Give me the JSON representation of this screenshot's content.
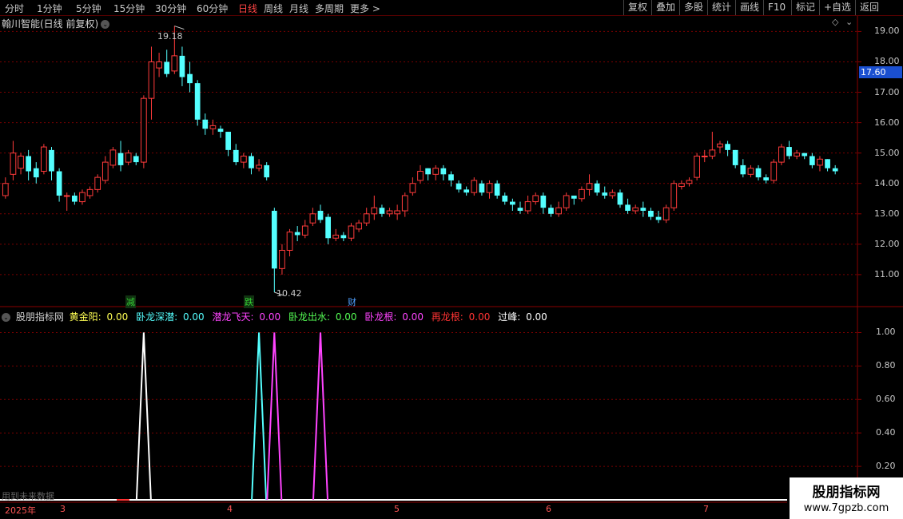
{
  "toolbar": {
    "periods": [
      "分时",
      "1分钟",
      "5分钟",
      "15分钟",
      "30分钟",
      "60分钟",
      "日线",
      "周线",
      "月线",
      "多周期",
      "更多 >"
    ],
    "active_period": "日线",
    "right_buttons": [
      "复权",
      "叠加",
      "多股",
      "统计",
      "画线",
      "F10",
      "标记",
      "+自选",
      "返回"
    ]
  },
  "price_panel": {
    "title": "翰川智能(日线 前复权)",
    "diamond_icon": "◇",
    "high_label": "19.18",
    "low_label": "10.42",
    "current_price": "17.60",
    "y_ticks": [
      "19.00",
      "18.00",
      "17.00",
      "16.00",
      "15.00",
      "14.00",
      "13.00",
      "12.00",
      "11.00"
    ],
    "markers": [
      {
        "text": "减",
        "color": "#33cc33"
      },
      {
        "text": "跌",
        "color": "#33cc33"
      },
      {
        "text": "财",
        "color": "#4fa0ff"
      }
    ]
  },
  "indicator_panel": {
    "name": "股朋指标网",
    "items": [
      {
        "label": "黄金阳:",
        "value": "0.00",
        "color": "#ffff55"
      },
      {
        "label": "卧龙深潜:",
        "value": "0.00",
        "color": "#55ffff"
      },
      {
        "label": "潜龙飞天:",
        "value": "0.00",
        "color": "#ff44ff"
      },
      {
        "label": "卧龙出水:",
        "value": "0.00",
        "color": "#55ff55"
      },
      {
        "label": "卧龙根:",
        "value": "0.00",
        "color": "#ff44ff"
      },
      {
        "label": "再龙根:",
        "value": "0.00",
        "color": "#ff3333"
      },
      {
        "label": "过峰:",
        "value": "0.00",
        "color": "#ffffff"
      }
    ],
    "y_ticks": [
      "1.00",
      "0.80",
      "0.60",
      "0.40",
      "0.20"
    ],
    "future_note": "用到未来数据"
  },
  "date_axis": {
    "year": "2025年",
    "months": [
      "3",
      "4",
      "5",
      "6",
      "7"
    ]
  },
  "watermark": {
    "line1": "股朋指标网",
    "line2": "www.7gpzb.com"
  },
  "chart_data": {
    "type": "candlestick",
    "ylim": [
      10.0,
      19.3
    ],
    "candles": [
      [
        13.6,
        14.0,
        13.5,
        14.2
      ],
      [
        14.3,
        15.0,
        14.1,
        15.4
      ],
      [
        14.5,
        14.9,
        14.3,
        15.0
      ],
      [
        14.9,
        14.4,
        14.1,
        15.1
      ],
      [
        14.5,
        14.2,
        14.0,
        14.7
      ],
      [
        14.4,
        15.2,
        14.3,
        15.3
      ],
      [
        15.1,
        14.4,
        14.1,
        15.2
      ],
      [
        14.4,
        13.6,
        13.4,
        14.5
      ],
      [
        13.6,
        13.6,
        13.1,
        13.7
      ],
      [
        13.6,
        13.4,
        13.3,
        13.7
      ],
      [
        13.4,
        13.7,
        13.3,
        13.8
      ],
      [
        13.6,
        13.8,
        13.5,
        13.9
      ],
      [
        13.8,
        14.2,
        13.7,
        14.3
      ],
      [
        14.1,
        14.7,
        14.0,
        14.9
      ],
      [
        14.6,
        15.1,
        14.5,
        15.2
      ],
      [
        15.0,
        14.6,
        14.4,
        15.4
      ],
      [
        14.7,
        15.0,
        14.6,
        15.1
      ],
      [
        14.9,
        14.7,
        14.6,
        15.0
      ],
      [
        14.7,
        16.8,
        14.5,
        16.9
      ],
      [
        16.8,
        18.0,
        16.1,
        18.5
      ],
      [
        17.8,
        18.0,
        17.5,
        18.3
      ],
      [
        18.0,
        17.6,
        17.5,
        18.4
      ],
      [
        17.7,
        18.2,
        17.6,
        19.18
      ],
      [
        18.2,
        17.5,
        17.2,
        18.5
      ],
      [
        17.6,
        17.3,
        17.0,
        18.0
      ],
      [
        17.3,
        16.1,
        15.9,
        17.4
      ],
      [
        16.1,
        15.8,
        15.6,
        16.3
      ],
      [
        15.8,
        15.9,
        15.6,
        16.1
      ],
      [
        15.8,
        15.7,
        15.5,
        15.9
      ],
      [
        15.7,
        15.1,
        14.9,
        15.7
      ],
      [
        15.1,
        14.7,
        14.6,
        15.3
      ],
      [
        14.7,
        14.9,
        14.5,
        15.0
      ],
      [
        14.9,
        14.5,
        14.3,
        15.0
      ],
      [
        14.5,
        14.6,
        14.4,
        14.8
      ],
      [
        14.6,
        14.2,
        14.1,
        14.7
      ],
      [
        13.1,
        11.2,
        10.42,
        13.2
      ],
      [
        11.2,
        11.8,
        11.0,
        12.0
      ],
      [
        11.8,
        12.4,
        11.6,
        12.5
      ],
      [
        12.4,
        12.3,
        12.1,
        12.6
      ],
      [
        12.3,
        12.6,
        12.2,
        12.8
      ],
      [
        12.7,
        13.0,
        12.6,
        13.2
      ],
      [
        13.1,
        12.8,
        12.7,
        13.3
      ],
      [
        12.9,
        12.2,
        12.0,
        13.0
      ],
      [
        12.2,
        12.3,
        12.1,
        12.5
      ],
      [
        12.3,
        12.2,
        12.1,
        12.4
      ],
      [
        12.2,
        12.6,
        12.1,
        12.7
      ],
      [
        12.5,
        12.7,
        12.4,
        12.8
      ],
      [
        12.7,
        13.0,
        12.6,
        13.2
      ],
      [
        13.0,
        13.2,
        12.8,
        13.6
      ],
      [
        13.2,
        13.0,
        12.9,
        13.3
      ],
      [
        13.0,
        13.1,
        12.9,
        13.2
      ],
      [
        13.0,
        13.1,
        12.8,
        13.3
      ],
      [
        13.1,
        13.6,
        12.9,
        13.7
      ],
      [
        13.7,
        14.0,
        13.6,
        14.2
      ],
      [
        14.1,
        14.4,
        14.0,
        14.6
      ],
      [
        14.5,
        14.3,
        14.1,
        14.5
      ],
      [
        14.3,
        14.5,
        14.1,
        14.6
      ],
      [
        14.5,
        14.3,
        14.1,
        14.6
      ],
      [
        14.3,
        14.1,
        13.9,
        14.4
      ],
      [
        14.0,
        13.8,
        13.7,
        14.1
      ],
      [
        13.8,
        13.7,
        13.6,
        13.9
      ],
      [
        13.7,
        14.1,
        13.6,
        14.2
      ],
      [
        14.0,
        13.7,
        13.6,
        14.1
      ],
      [
        13.7,
        14.0,
        13.5,
        14.1
      ],
      [
        14.0,
        13.6,
        13.5,
        14.1
      ],
      [
        13.6,
        13.4,
        13.3,
        13.7
      ],
      [
        13.4,
        13.3,
        13.1,
        13.5
      ],
      [
        13.2,
        13.1,
        13.0,
        13.4
      ],
      [
        13.1,
        13.4,
        13.0,
        13.6
      ],
      [
        13.4,
        13.6,
        13.3,
        13.7
      ],
      [
        13.6,
        13.2,
        13.0,
        13.7
      ],
      [
        13.2,
        13.0,
        12.9,
        13.3
      ],
      [
        13.0,
        13.2,
        12.9,
        13.4
      ],
      [
        13.2,
        13.6,
        13.1,
        13.7
      ],
      [
        13.6,
        13.5,
        13.3,
        13.6
      ],
      [
        13.5,
        13.8,
        13.4,
        13.9
      ],
      [
        13.8,
        14.0,
        13.6,
        14.3
      ],
      [
        14.0,
        13.7,
        13.6,
        14.1
      ],
      [
        13.7,
        13.6,
        13.5,
        13.9
      ],
      [
        13.6,
        13.7,
        13.5,
        13.8
      ],
      [
        13.7,
        13.3,
        13.2,
        13.8
      ],
      [
        13.3,
        13.1,
        13.0,
        13.5
      ],
      [
        13.1,
        13.2,
        13.0,
        13.3
      ],
      [
        13.2,
        13.1,
        12.9,
        13.4
      ],
      [
        13.1,
        12.9,
        12.8,
        13.2
      ],
      [
        12.9,
        12.8,
        12.7,
        13.1
      ],
      [
        12.8,
        13.2,
        12.7,
        13.3
      ],
      [
        13.2,
        14.0,
        13.1,
        14.1
      ],
      [
        13.9,
        14.0,
        13.8,
        14.1
      ],
      [
        14.0,
        14.1,
        13.9,
        14.2
      ],
      [
        14.2,
        14.9,
        14.1,
        15.0
      ],
      [
        14.9,
        14.9,
        14.7,
        15.1
      ],
      [
        14.9,
        15.1,
        14.8,
        15.7
      ],
      [
        15.2,
        15.3,
        15.0,
        15.4
      ],
      [
        15.3,
        15.1,
        14.9,
        15.4
      ],
      [
        15.1,
        14.6,
        14.5,
        15.1
      ],
      [
        14.6,
        14.3,
        14.2,
        14.8
      ],
      [
        14.3,
        14.5,
        14.2,
        14.6
      ],
      [
        14.5,
        14.2,
        14.1,
        14.6
      ],
      [
        14.2,
        14.1,
        14.0,
        14.3
      ],
      [
        14.1,
        14.7,
        14.0,
        14.8
      ],
      [
        14.7,
        15.2,
        14.6,
        15.3
      ],
      [
        15.2,
        14.9,
        14.8,
        15.4
      ],
      [
        14.9,
        15.0,
        14.8,
        15.1
      ],
      [
        15.0,
        14.9,
        14.8,
        15.0
      ],
      [
        14.9,
        14.6,
        14.5,
        15.0
      ],
      [
        14.6,
        14.8,
        14.4,
        14.9
      ],
      [
        14.8,
        14.5,
        14.4,
        14.8
      ],
      [
        14.5,
        14.4,
        14.3,
        14.6
      ]
    ],
    "indicator_spikes": [
      {
        "series": "过峰",
        "color": "#ffffff",
        "index": 18,
        "value": 1.0
      },
      {
        "series": "卧龙深潜",
        "color": "#55ffff",
        "index": 33,
        "value": 1.0
      },
      {
        "series": "潜龙飞天",
        "color": "#ff44ff",
        "index": 35,
        "value": 1.0
      },
      {
        "series": "卧龙根",
        "color": "#ff44ff",
        "index": 41,
        "value": 1.0
      }
    ],
    "indicator_ylim": [
      0,
      1.0
    ]
  }
}
